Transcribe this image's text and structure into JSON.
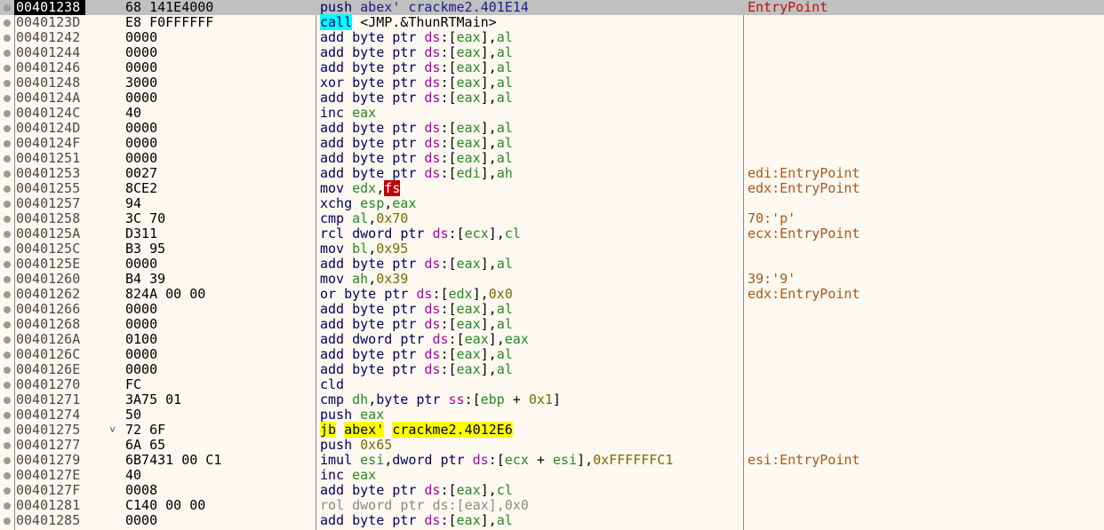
{
  "disasm": {
    "rows": [
      {
        "addr": "00401238",
        "bytes": "68 141E4000",
        "instr": "push abex' crackme2.401E14",
        "comment": "EntryPoint",
        "selected": true
      },
      {
        "addr": "0040123D",
        "bytes": "E8 F0FFFFFF",
        "instr": "call <JMP.&ThunRTMain>",
        "comment": ""
      },
      {
        "addr": "00401242",
        "bytes": "0000",
        "instr": "add byte ptr ds:[eax],al",
        "comment": ""
      },
      {
        "addr": "00401244",
        "bytes": "0000",
        "instr": "add byte ptr ds:[eax],al",
        "comment": ""
      },
      {
        "addr": "00401246",
        "bytes": "0000",
        "instr": "add byte ptr ds:[eax],al",
        "comment": ""
      },
      {
        "addr": "00401248",
        "bytes": "3000",
        "instr": "xor byte ptr ds:[eax],al",
        "comment": ""
      },
      {
        "addr": "0040124A",
        "bytes": "0000",
        "instr": "add byte ptr ds:[eax],al",
        "comment": ""
      },
      {
        "addr": "0040124C",
        "bytes": "40",
        "instr": "inc eax",
        "comment": ""
      },
      {
        "addr": "0040124D",
        "bytes": "0000",
        "instr": "add byte ptr ds:[eax],al",
        "comment": ""
      },
      {
        "addr": "0040124F",
        "bytes": "0000",
        "instr": "add byte ptr ds:[eax],al",
        "comment": ""
      },
      {
        "addr": "00401251",
        "bytes": "0000",
        "instr": "add byte ptr ds:[eax],al",
        "comment": ""
      },
      {
        "addr": "00401253",
        "bytes": "0027",
        "instr": "add byte ptr ds:[edi],ah",
        "comment": "edi:EntryPoint"
      },
      {
        "addr": "00401255",
        "bytes": "8CE2",
        "instr": "mov edx,fs",
        "comment": "edx:EntryPoint"
      },
      {
        "addr": "00401257",
        "bytes": "94",
        "instr": "xchg esp,eax",
        "comment": ""
      },
      {
        "addr": "00401258",
        "bytes": "3C 70",
        "instr": "cmp al,0x70",
        "comment": "70:'p'"
      },
      {
        "addr": "0040125A",
        "bytes": "D311",
        "instr": "rcl dword ptr ds:[ecx],cl",
        "comment": "ecx:EntryPoint"
      },
      {
        "addr": "0040125C",
        "bytes": "B3 95",
        "instr": "mov bl,0x95",
        "comment": ""
      },
      {
        "addr": "0040125E",
        "bytes": "0000",
        "instr": "add byte ptr ds:[eax],al",
        "comment": ""
      },
      {
        "addr": "00401260",
        "bytes": "B4 39",
        "instr": "mov ah,0x39",
        "comment": "39:'9'"
      },
      {
        "addr": "00401262",
        "bytes": "824A 00 00",
        "instr": "or byte ptr ds:[edx],0x0",
        "comment": "edx:EntryPoint"
      },
      {
        "addr": "00401266",
        "bytes": "0000",
        "instr": "add byte ptr ds:[eax],al",
        "comment": ""
      },
      {
        "addr": "00401268",
        "bytes": "0000",
        "instr": "add byte ptr ds:[eax],al",
        "comment": ""
      },
      {
        "addr": "0040126A",
        "bytes": "0100",
        "instr": "add dword ptr ds:[eax],eax",
        "comment": ""
      },
      {
        "addr": "0040126C",
        "bytes": "0000",
        "instr": "add byte ptr ds:[eax],al",
        "comment": ""
      },
      {
        "addr": "0040126E",
        "bytes": "0000",
        "instr": "add byte ptr ds:[eax],al",
        "comment": ""
      },
      {
        "addr": "00401270",
        "bytes": "FC",
        "instr": "cld",
        "comment": ""
      },
      {
        "addr": "00401271",
        "bytes": "3A75 01",
        "instr": "cmp dh,byte ptr ss:[ebp + 0x1]",
        "comment": ""
      },
      {
        "addr": "00401274",
        "bytes": "50",
        "instr": "push eax",
        "comment": ""
      },
      {
        "addr": "00401275",
        "bytes": "72 6F",
        "instr": "jb abex' crackme2.4012E6",
        "comment": "",
        "arrow": "˅"
      },
      {
        "addr": "00401277",
        "bytes": "6A 65",
        "instr": "push 0x65",
        "comment": ""
      },
      {
        "addr": "00401279",
        "bytes": "6B7431 00 C1",
        "instr": "imul esi,dword ptr ds:[ecx + esi],0xFFFFFFC1",
        "comment": "esi:EntryPoint"
      },
      {
        "addr": "0040127E",
        "bytes": "40",
        "instr": "inc eax",
        "comment": ""
      },
      {
        "addr": "0040127F",
        "bytes": "0008",
        "instr": "add byte ptr ds:[eax],cl",
        "comment": ""
      },
      {
        "addr": "00401281",
        "bytes": "C140 00 00",
        "instr": "rol dword ptr ds:[eax],0x0",
        "comment": ""
      },
      {
        "addr": "00401285",
        "bytes": "0000",
        "instr": "add byte ptr ds:[eax],al",
        "comment": ""
      }
    ]
  },
  "colors": {
    "background": "#fdf8f0",
    "selected_row": "#c0c0c0",
    "comment": "#a55a1c",
    "call_highlight": "#00ffff",
    "jump_highlight": "#ffff00"
  },
  "icons": {
    "breakpoint": "breakpoint-dot-icon",
    "jump_arrow": "jump-arrow-icon"
  }
}
